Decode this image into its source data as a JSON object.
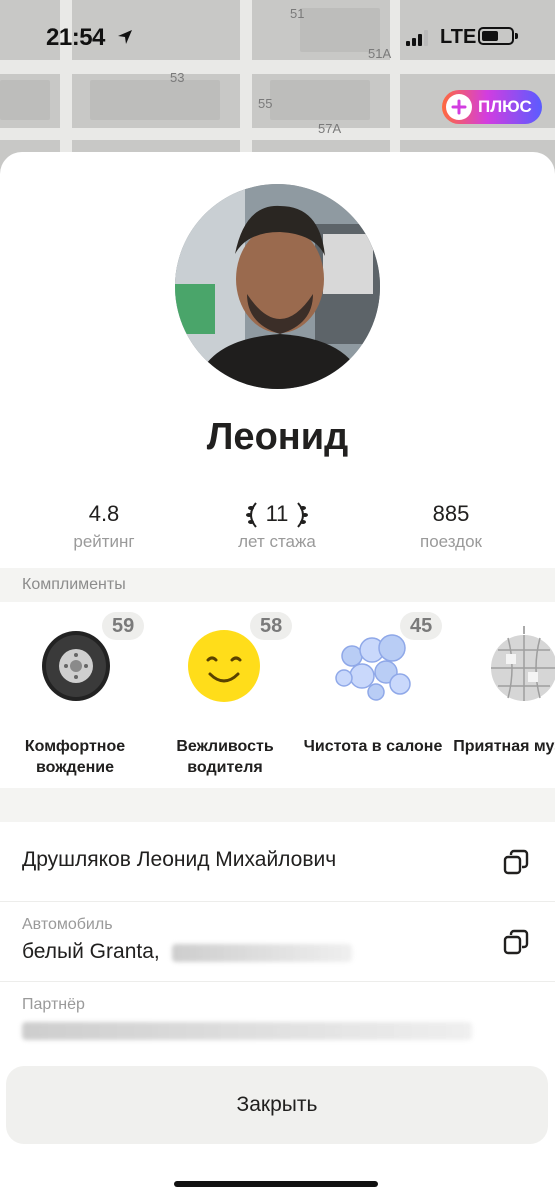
{
  "status_bar": {
    "time": "21:54",
    "network": "LTE"
  },
  "map": {
    "labels": [
      "51",
      "51A",
      "53",
      "55",
      "57A"
    ]
  },
  "plus_badge": {
    "label": "ПЛЮС",
    "icon": "plus-logo-icon"
  },
  "driver": {
    "name": "Леонид",
    "stats": [
      {
        "value": "4.8",
        "label": "рейтинг"
      },
      {
        "value": "11",
        "label": "лет стажа"
      },
      {
        "value": "885",
        "label": "поездок"
      }
    ]
  },
  "compliments": {
    "title": "Комплименты",
    "items": [
      {
        "count": "59",
        "label": "Комфортное вождение",
        "icon": "wheel-icon"
      },
      {
        "count": "58",
        "label": "Вежливость водителя",
        "icon": "smile-icon"
      },
      {
        "count": "45",
        "label": "Чистота в салоне",
        "icon": "bubbles-icon"
      },
      {
        "count": "",
        "label": "Приятная музыка",
        "icon": "disco-ball-icon"
      }
    ]
  },
  "details": {
    "full_name": "Друшляков Леонид Михайлович",
    "car_label": "Автомобиль",
    "car_value": "белый Granta,",
    "partner_label": "Партнёр"
  },
  "close_label": "Закрыть",
  "colors": {
    "plus_gradient": [
      "#ff6a3d",
      "#d23de0",
      "#5a5cff"
    ],
    "smile": "#ffdd1a",
    "text": "#21201f",
    "muted": "#9a9a9a"
  }
}
